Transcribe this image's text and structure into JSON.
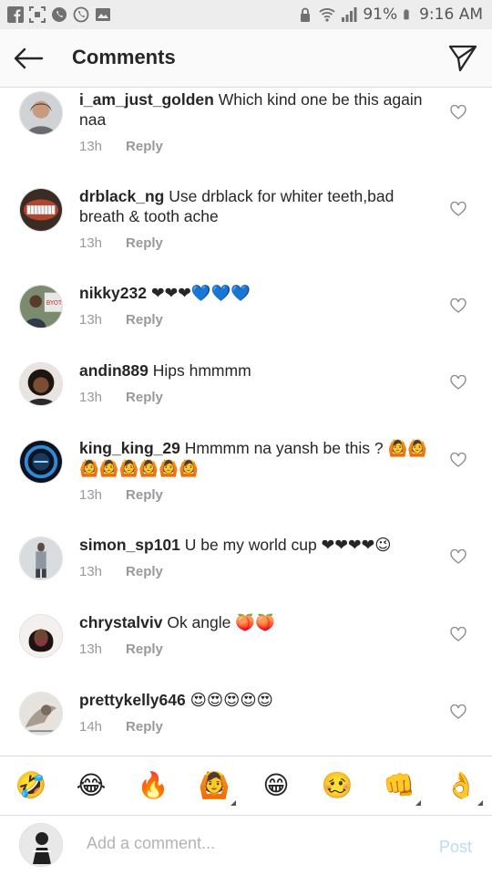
{
  "status_bar": {
    "battery": "91%",
    "time": "9:16 AM"
  },
  "header": {
    "title": "Comments"
  },
  "comments": [
    {
      "username": "i_am_just_golden",
      "text": "Which kind one be this again naa",
      "time": "13h",
      "reply": "Reply"
    },
    {
      "username": "drblack_ng",
      "text": "Use drblack for whiter teeth,bad breath & tooth ache",
      "time": "13h",
      "reply": "Reply"
    },
    {
      "username": "nikky232",
      "text": "❤❤❤💙💙💙",
      "time": "13h",
      "reply": "Reply"
    },
    {
      "username": "andin889",
      "text": "Hips hmmmm",
      "time": "13h",
      "reply": "Reply"
    },
    {
      "username": "king_king_29",
      "text": "Hmmmm na yansh be this ? 🙆🙆🙆🙆🙆🙆🙆🙆",
      "time": "13h",
      "reply": "Reply"
    },
    {
      "username": "simon_sp101",
      "text": "U be my world cup ❤❤❤❤😉",
      "time": "13h",
      "reply": "Reply"
    },
    {
      "username": "chrystalviv",
      "text": "Ok angle 🍑🍑",
      "time": "13h",
      "reply": "Reply"
    },
    {
      "username": "prettykelly646",
      "text": "😍😍😍😍😍",
      "time": "14h",
      "reply": "Reply"
    }
  ],
  "emoji_bar": [
    "🤣",
    "😂",
    "🔥",
    "🙆",
    "😁",
    "🥴",
    "👊",
    "👌"
  ],
  "composer": {
    "placeholder": "Add a comment...",
    "post_label": "Post"
  },
  "colors": {
    "accent_post_disabled": "#b9dcf7",
    "heart_red": "#e8344e",
    "heart_blue": "#1e90e8"
  }
}
